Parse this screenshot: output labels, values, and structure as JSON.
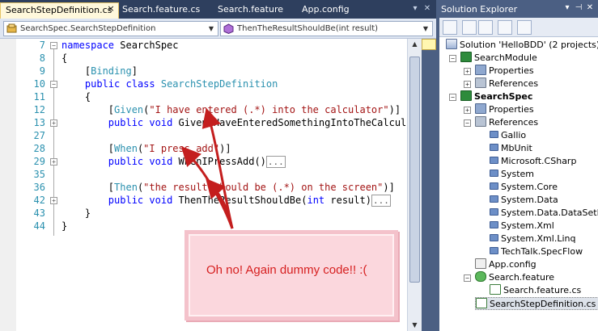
{
  "tabs": [
    {
      "label": "SearchStepDefinition.cs",
      "active": true
    },
    {
      "label": "Search.feature.cs",
      "active": false
    },
    {
      "label": "Search.feature",
      "active": false
    },
    {
      "label": "App.config",
      "active": false
    }
  ],
  "tab_close_glyph": "×",
  "navbar": {
    "type_combo": "SearchSpec.SearchStepDefinition",
    "member_combo": "ThenTheResultShouldBe(int result)"
  },
  "editor": {
    "line_numbers": [
      "7",
      "8",
      "9",
      "10",
      "11",
      "12",
      "13",
      "27",
      "28",
      "29",
      "35",
      "36",
      "42",
      "43",
      "44"
    ],
    "lines": [
      [
        {
          "t": "namespace",
          "c": "kw"
        },
        {
          "t": " SearchSpec",
          "c": ""
        }
      ],
      [
        {
          "t": "{",
          "c": ""
        }
      ],
      [
        {
          "t": "    [",
          "c": ""
        },
        {
          "t": "Binding",
          "c": "ty"
        },
        {
          "t": "]",
          "c": ""
        }
      ],
      [
        {
          "t": "    ",
          "c": ""
        },
        {
          "t": "public",
          "c": "kw"
        },
        {
          "t": " ",
          "c": ""
        },
        {
          "t": "class",
          "c": "kw"
        },
        {
          "t": " ",
          "c": ""
        },
        {
          "t": "SearchStepDefinition",
          "c": "ty"
        }
      ],
      [
        {
          "t": "    {",
          "c": ""
        }
      ],
      [
        {
          "t": "        [",
          "c": ""
        },
        {
          "t": "Given",
          "c": "ty"
        },
        {
          "t": "(",
          "c": ""
        },
        {
          "t": "\"I have entered (.*) into the calculator\"",
          "c": "str"
        },
        {
          "t": ")]",
          "c": ""
        }
      ],
      [
        {
          "t": "        ",
          "c": ""
        },
        {
          "t": "public",
          "c": "kw"
        },
        {
          "t": " ",
          "c": ""
        },
        {
          "t": "void",
          "c": "kw"
        },
        {
          "t": " GivenIHaveEnteredSomethingIntoTheCalculator",
          "c": ""
        }
      ],
      [
        {
          "t": "",
          "c": ""
        }
      ],
      [
        {
          "t": "        [",
          "c": ""
        },
        {
          "t": "When",
          "c": "ty"
        },
        {
          "t": "(",
          "c": ""
        },
        {
          "t": "\"I press add\"",
          "c": "str"
        },
        {
          "t": ")]",
          "c": ""
        }
      ],
      [
        {
          "t": "        ",
          "c": ""
        },
        {
          "t": "public",
          "c": "kw"
        },
        {
          "t": " ",
          "c": ""
        },
        {
          "t": "void",
          "c": "kw"
        },
        {
          "t": " WhenIPressAdd()",
          "c": ""
        },
        {
          "t": "...",
          "c": "box"
        }
      ],
      [
        {
          "t": "",
          "c": ""
        }
      ],
      [
        {
          "t": "        [",
          "c": ""
        },
        {
          "t": "Then",
          "c": "ty"
        },
        {
          "t": "(",
          "c": ""
        },
        {
          "t": "\"the result should be (.*) on the screen\"",
          "c": "str"
        },
        {
          "t": ")]",
          "c": ""
        }
      ],
      [
        {
          "t": "        ",
          "c": ""
        },
        {
          "t": "public",
          "c": "kw"
        },
        {
          "t": " ",
          "c": ""
        },
        {
          "t": "void",
          "c": "kw"
        },
        {
          "t": " ThenTheResultShouldBe(",
          "c": ""
        },
        {
          "t": "int",
          "c": "kw"
        },
        {
          "t": " result)",
          "c": ""
        },
        {
          "t": "...",
          "c": "box"
        }
      ],
      [
        {
          "t": "    }",
          "c": ""
        }
      ],
      [
        {
          "t": "}",
          "c": ""
        }
      ]
    ],
    "callout_text": "Oh no! Again dummy code!! :("
  },
  "solution_explorer": {
    "title": "Solution Explorer",
    "tree": [
      {
        "label": "Solution 'HelloBDD' (2 projects)",
        "icon": "solution-icon",
        "ic": "ic-sln",
        "bold": false
      },
      {
        "label": "SearchModule",
        "icon": "csharp-project-icon",
        "ic": "ic-proj",
        "bold": false
      },
      {
        "label": "Properties",
        "icon": "properties-icon",
        "ic": "ic-props",
        "bold": false
      },
      {
        "label": "References",
        "icon": "references-icon",
        "ic": "ic-refs",
        "bold": false
      },
      {
        "label": "SearchSpec",
        "icon": "csharp-project-icon",
        "ic": "ic-proj",
        "bold": true
      },
      {
        "label": "Properties",
        "icon": "properties-icon",
        "ic": "ic-props",
        "bold": false
      },
      {
        "label": "References",
        "icon": "references-icon",
        "ic": "ic-refs",
        "bold": false
      },
      {
        "label": "Gallio",
        "icon": "assembly-icon",
        "ic": "ic-asm",
        "bold": false
      },
      {
        "label": "MbUnit",
        "icon": "assembly-icon",
        "ic": "ic-asm",
        "bold": false
      },
      {
        "label": "Microsoft.CSharp",
        "icon": "assembly-icon",
        "ic": "ic-asm",
        "bold": false
      },
      {
        "label": "System",
        "icon": "assembly-icon",
        "ic": "ic-asm",
        "bold": false
      },
      {
        "label": "System.Core",
        "icon": "assembly-icon",
        "ic": "ic-asm",
        "bold": false
      },
      {
        "label": "System.Data",
        "icon": "assembly-icon",
        "ic": "ic-asm",
        "bold": false
      },
      {
        "label": "System.Data.DataSetExtensions",
        "icon": "assembly-icon",
        "ic": "ic-asm",
        "bold": false
      },
      {
        "label": "System.Xml",
        "icon": "assembly-icon",
        "ic": "ic-asm",
        "bold": false
      },
      {
        "label": "System.Xml.Linq",
        "icon": "assembly-icon",
        "ic": "ic-asm",
        "bold": false
      },
      {
        "label": "TechTalk.SpecFlow",
        "icon": "assembly-icon",
        "ic": "ic-asm",
        "bold": false
      },
      {
        "label": "App.config",
        "icon": "config-file-icon",
        "ic": "ic-config",
        "bold": false
      },
      {
        "label": "Search.feature",
        "icon": "feature-file-icon",
        "ic": "ic-feature",
        "bold": false
      },
      {
        "label": "Search.feature.cs",
        "icon": "csharp-file-icon",
        "ic": "ic-cs",
        "bold": false
      },
      {
        "label": "SearchStepDefinition.cs",
        "icon": "csharp-file-icon",
        "ic": "ic-cs",
        "bold": false,
        "selected": true
      }
    ]
  }
}
